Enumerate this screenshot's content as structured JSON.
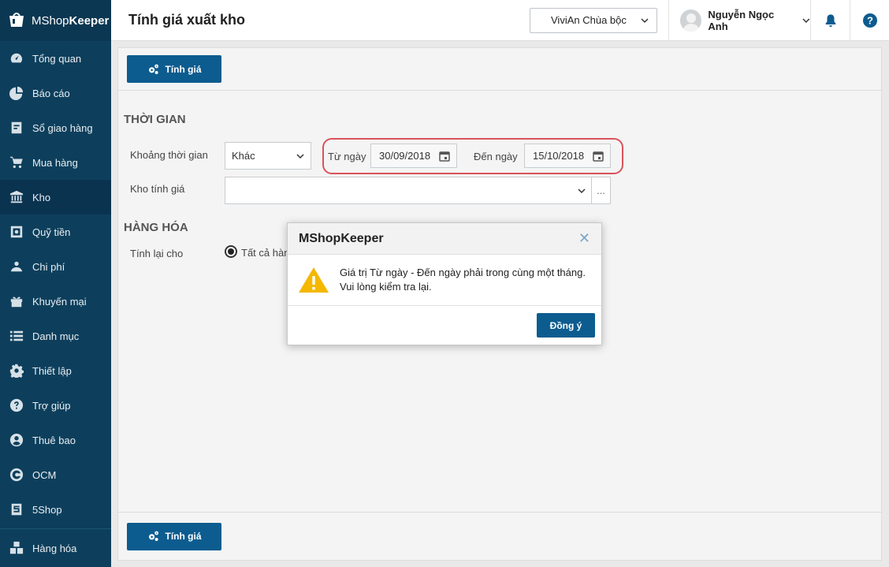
{
  "brand": {
    "prefix": "MShop",
    "suffix": "Keeper"
  },
  "sidebar": {
    "items": [
      {
        "label": "Tổng quan",
        "icon": "dashboard-icon"
      },
      {
        "label": "Báo cáo",
        "icon": "pie-chart-icon"
      },
      {
        "label": "Sổ giao hàng",
        "icon": "delivery-book-icon"
      },
      {
        "label": "Mua hàng",
        "icon": "cart-icon"
      },
      {
        "label": "Kho",
        "icon": "warehouse-icon",
        "active": true
      },
      {
        "label": "Quỹ tiền",
        "icon": "safe-icon"
      },
      {
        "label": "Chi phí",
        "icon": "expense-icon"
      },
      {
        "label": "Khuyến mại",
        "icon": "gift-icon"
      },
      {
        "label": "Danh mục",
        "icon": "list-icon"
      },
      {
        "label": "Thiết lập",
        "icon": "gear-icon"
      },
      {
        "label": "Trợ giúp",
        "icon": "help-icon"
      },
      {
        "label": "Thuê bao",
        "icon": "user-icon"
      },
      {
        "label": "OCM",
        "icon": "ocm-icon"
      },
      {
        "label": "5Shop",
        "icon": "5shop-icon"
      }
    ],
    "bottom": {
      "label": "Hàng hóa",
      "icon": "boxes-icon"
    }
  },
  "header": {
    "title": "Tính giá xuất kho",
    "store": "ViviAn Chùa bộc",
    "user": "Nguyễn Ngọc Anh"
  },
  "toolbar": {
    "calc_label": "Tính giá"
  },
  "time_section": {
    "title": "THỜI GIAN",
    "period_label": "Khoảng thời gian",
    "period_value": "Khác",
    "from_label": "Từ ngày",
    "from_value": "30/09/2018",
    "to_label": "Đến ngày",
    "to_value": "15/10/2018",
    "warehouse_label": "Kho tính giá",
    "warehouse_value": "",
    "more_label": "..."
  },
  "goods_section": {
    "title": "HÀNG HÓA",
    "recalc_label": "Tính lại cho",
    "option_all": "Tất cả hàn"
  },
  "modal": {
    "title": "MShopKeeper",
    "close": "✕",
    "line1": "Giá trị Từ ngày - Đến ngày phải trong cùng một tháng.",
    "line2": "Vui lòng kiểm tra lại.",
    "ok_label": "Đồng ý"
  },
  "colors": {
    "sidebar": "#0d3f5c",
    "primary": "#0d5c8f",
    "highlight": "#d9535b",
    "warning": "#f5b800"
  }
}
